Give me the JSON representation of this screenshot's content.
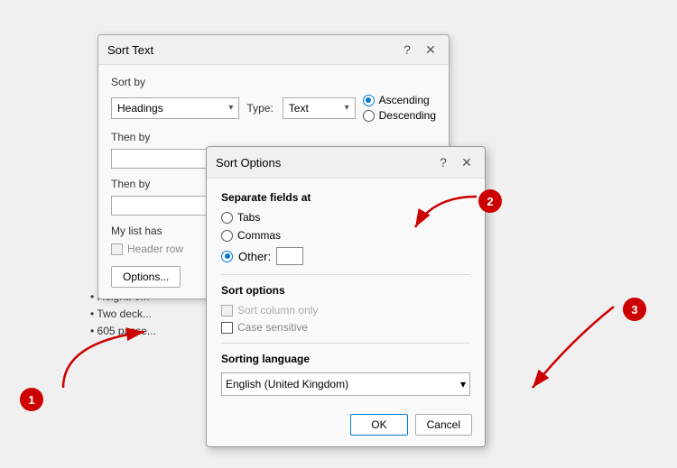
{
  "background": {
    "color": "#f0f0f0"
  },
  "sort_text_dialog": {
    "title": "Sort Text",
    "help_btn": "?",
    "close_btn": "✕",
    "sort_by_label": "Sort by",
    "sort_by_value": "Headings",
    "type_label": "Type:",
    "type_value": "Text",
    "ascending_label": "Ascending",
    "descending_label": "Descending",
    "then_by_label1": "Then by",
    "then_by_label2": "Then by",
    "my_list_label": "My list has",
    "header_row_label": "Header row",
    "options_btn_label": "Options..."
  },
  "doc_lines": [
    "Height: 0...",
    "Two deck...",
    "605 passe..."
  ],
  "sort_options_dialog": {
    "title": "Sort Options",
    "help_btn": "?",
    "close_btn": "✕",
    "separate_fields_label": "Separate fields at",
    "tabs_label": "Tabs",
    "commas_label": "Commas",
    "other_label": "Other:",
    "sort_options_label": "Sort options",
    "sort_column_only_label": "Sort column only",
    "case_sensitive_label": "Case sensitive",
    "sorting_language_label": "Sorting language",
    "language_value": "English (United Kingdom)",
    "ok_label": "OK",
    "cancel_label": "Cancel"
  },
  "badges": {
    "one": "1",
    "two": "2",
    "three": "3"
  }
}
